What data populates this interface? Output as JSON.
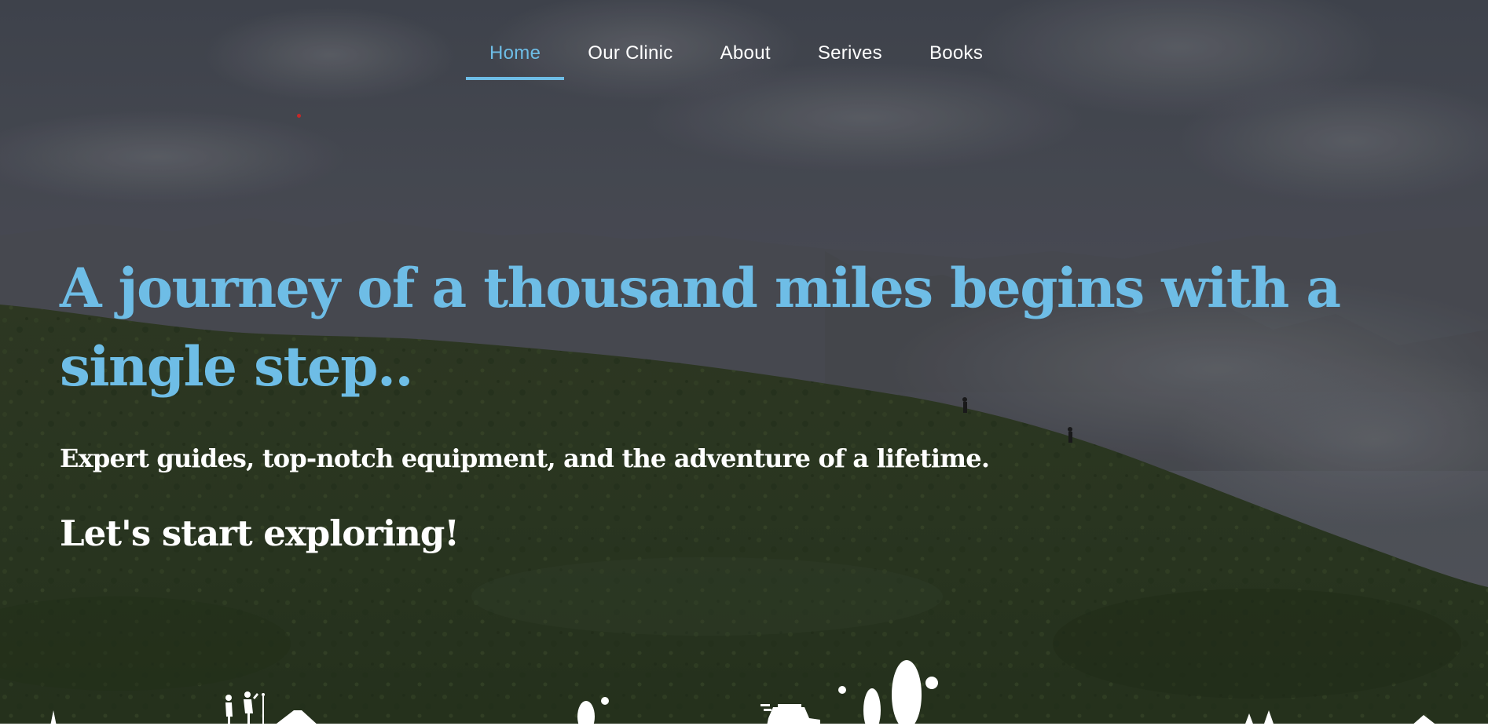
{
  "nav": {
    "items": [
      {
        "label": "Home",
        "active": true
      },
      {
        "label": "Our Clinic",
        "active": false
      },
      {
        "label": "About",
        "active": false
      },
      {
        "label": "Serives",
        "active": false
      },
      {
        "label": "Books",
        "active": false
      }
    ]
  },
  "hero": {
    "headline": "A journey of a thousand miles begins with a single step..",
    "subheadline": "Expert guides, top-notch equipment, and the adventure of a lifetime.",
    "cta_text": "Let's start exploring!"
  },
  "colors": {
    "accent": "#6ebde6",
    "text": "#ffffff",
    "sky": "#4a4f58",
    "grass": "#2e3a1e"
  }
}
